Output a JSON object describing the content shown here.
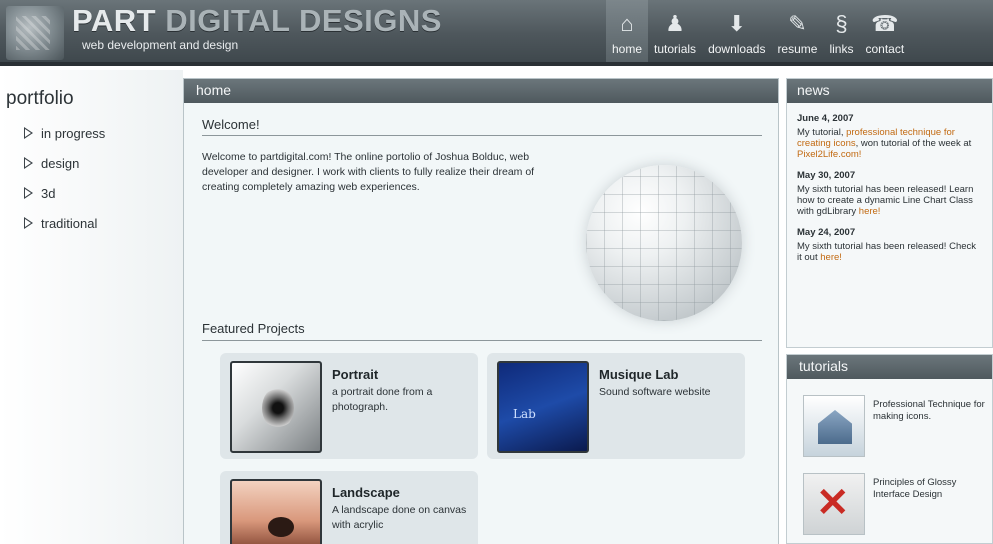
{
  "header": {
    "title_a": "PART ",
    "title_b": "DIGITAL DESIGNS",
    "tagline": "web development and design",
    "nav": [
      {
        "label": "home",
        "icon": "home-icon",
        "glyph": "⌂"
      },
      {
        "label": "tutorials",
        "icon": "tutorials-icon",
        "glyph": "♟"
      },
      {
        "label": "downloads",
        "icon": "download-icon",
        "glyph": "⬇"
      },
      {
        "label": "resume",
        "icon": "resume-icon",
        "glyph": "✎"
      },
      {
        "label": "links",
        "icon": "links-icon",
        "glyph": "§"
      },
      {
        "label": "contact",
        "icon": "contact-icon",
        "glyph": "☎"
      }
    ]
  },
  "sidebar": {
    "title": "portfolio",
    "items": [
      {
        "label": "in progress"
      },
      {
        "label": "design"
      },
      {
        "label": "3d"
      },
      {
        "label": "traditional"
      }
    ]
  },
  "main": {
    "header": "home",
    "welcome": "Welcome!",
    "intro": "Welcome to partdigital.com! The online portolio of Joshua Bolduc, web developer and designer. I work with clients to fully realize their dream of creating completely amazing web experiences.",
    "featured_heading": "Featured Projects",
    "projects": [
      {
        "title": "Portrait",
        "desc": "a portrait done from a photograph."
      },
      {
        "title": "Musique Lab",
        "desc": "Sound software website"
      },
      {
        "title": "Landscape",
        "desc": "A landscape done on canvas with acrylic"
      }
    ]
  },
  "news": {
    "header": "news",
    "entries": [
      {
        "date": "June 4, 2007",
        "pre": "My tutorial, ",
        "link": "professional technique for creating icons",
        "post": ", won tutorial of the week at",
        "link2": "Pixel2Life.com!",
        "post2": ""
      },
      {
        "date": "May 30, 2007",
        "pre": "My sixth tutorial has been released! Learn how to create a dynamic Line Chart Class with gdLibrary ",
        "link": "here!",
        "post": "",
        "link2": "",
        "post2": ""
      },
      {
        "date": "May 24, 2007",
        "pre": "My sixth tutorial has been released! Check it out ",
        "link": "here!",
        "post": "",
        "link2": "",
        "post2": ""
      }
    ]
  },
  "tutorials": {
    "header": "tutorials",
    "items": [
      {
        "text": "Professional Technique for making icons."
      },
      {
        "text": "Principles of Glossy Interface Design"
      }
    ]
  }
}
